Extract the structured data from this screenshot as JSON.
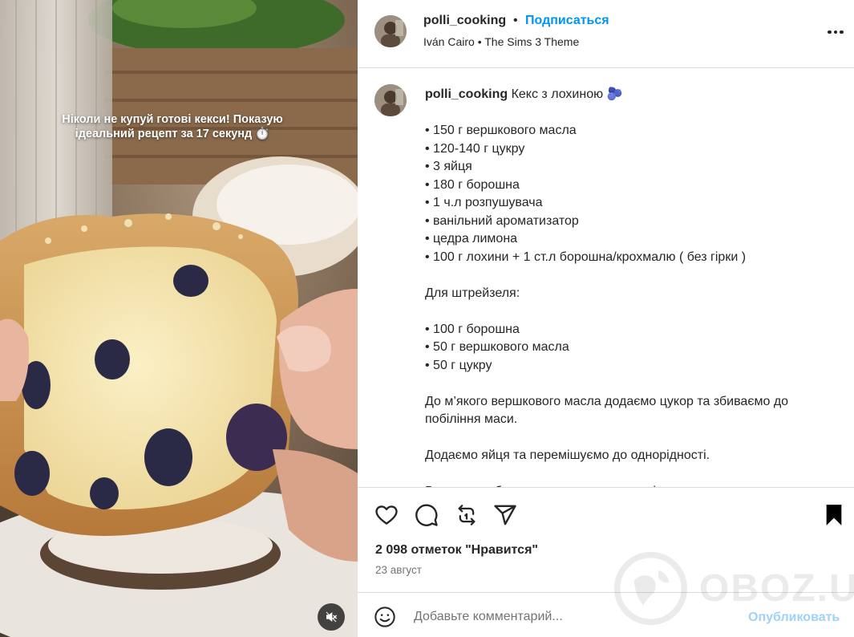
{
  "media": {
    "overlay_line1": "Ніколи не купуй готові кекси! Показую",
    "overlay_line2": "ідеальний рецепт за 17 секунд ⏱️",
    "mute_icon": "speaker-muted-icon"
  },
  "header": {
    "username": "polli_cooking",
    "dot": "•",
    "follow_label": "Подписаться",
    "audio": "Iván Cairo • The Sims 3 Theme",
    "more_icon": "more-horizontal-icon"
  },
  "caption": {
    "username": "polli_cooking",
    "title": " Кекс з лохиною 🫐",
    "lines": [
      "",
      "• 150 г вершкового масла",
      "• 120-140 г цукру",
      "• 3 яйця",
      "• 180 г борошна",
      "• 1 ч.л розпушувача",
      "• ванільний ароматизатор",
      "• цедра лимона",
      "• 100 г лохини + 1 ст.л борошна/крохмалю ( без гірки )",
      "",
      "Для штрейзеля:",
      "",
      "• 100 г борошна",
      "• 50 г вершкового масла",
      "• 50 г цукру",
      "",
      "До м’якого вершкового масла додаємо цукор та збиваємо до побіління маси.",
      "",
      "Додаємо яйця та перемішуємо до однорідності.",
      "",
      "Висипаємо борошно, розпушувач, ваніль та цедру лимона."
    ]
  },
  "actions": {
    "like_icon": "heart-icon",
    "comment_icon": "comment-icon",
    "repost_icon": "repost-icon",
    "share_icon": "share-icon",
    "save_icon": "bookmark-icon"
  },
  "likes": "2 098 отметок \"Нравится\"",
  "date": "23 август",
  "comment": {
    "placeholder": "Добавьте комментарий...",
    "publish_label": "Опубликовать",
    "emoji_icon": "emoji-icon"
  },
  "watermark": "OBOZ.UA",
  "colors": {
    "link_blue": "#0095f6",
    "publish_disabled": "#9fd2f7",
    "text": "#262626",
    "secondary": "#737373",
    "border": "#dbdbdb"
  }
}
